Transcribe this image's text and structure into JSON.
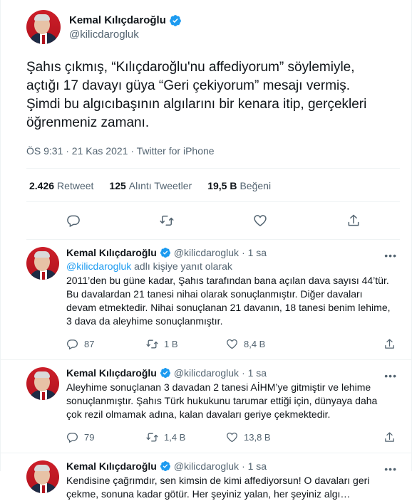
{
  "main_tweet": {
    "display_name": "Kemal Kılıçdaroğlu",
    "handle": "@kilicdarogluk",
    "text": "Şahıs çıkmış, “Kılıçdaroğlu'nu affediyorum” söylemiyle, açtığı 17 davayı güya “Geri çekiyorum” mesajı vermiş. Şimdi bu algıcıbaşının algılarını bir kenara itip, gerçekleri öğrenmeniz zamanı.",
    "meta": "ÖS 9:31 · 21 Kas 2021 · Twitter for iPhone",
    "stats": {
      "retweets_count": "2.426",
      "retweets_label": "Retweet",
      "quotes_count": "125",
      "quotes_label": "Alıntı Tweetler",
      "likes_count": "19,5 B",
      "likes_label": "Beğeni"
    }
  },
  "replies": [
    {
      "display_name": "Kemal Kılıçdaroğlu",
      "handle": "@kilicdarogluk",
      "time": "· 1 sa",
      "replying_to": "@kilicdarogluk",
      "replying_suffix": "adlı kişiye yanıt olarak",
      "text": "2011’den bu güne kadar, Şahıs tarafından bana açılan dava sayısı 44’tür. Bu davalardan 21 tanesi nihai olarak sonuçlanmıştır. Diğer davaları devam etmektedir. Nihai sonuçlanan 21 davanın, 18 tanesi benim lehime, 3 dava da aleyhime sonuçlanmıştır.",
      "reply_count": "87",
      "retweet_count": "1 B",
      "like_count": "8,4 B"
    },
    {
      "display_name": "Kemal Kılıçdaroğlu",
      "handle": "@kilicdarogluk",
      "time": "· 1 sa",
      "text": "Aleyhime sonuçlanan 3 davadan 2 tanesi AİHM’ye gitmiştir ve lehime sonuçlanmıştır. Şahıs Türk hukukunu tarumar ettiği için, dünyaya daha çok rezil olmamak adına, kalan davaları geriye çekmektedir.",
      "reply_count": "79",
      "retweet_count": "1,4 B",
      "like_count": "13,8 B"
    },
    {
      "display_name": "Kemal Kılıçdaroğlu",
      "handle": "@kilicdarogluk",
      "time": "· 1 sa",
      "text": "Kendisine çağrımdır, sen kimsin de kimi affediyorsun! O davaları geri çekme, sonuna kadar götür. Her şeyiniz yalan, her şeyiniz algı…"
    }
  ],
  "colors": {
    "accent": "#1d9bf0",
    "gray": "#536471",
    "verified": "#1d9bf0"
  },
  "icons": [
    "verified-badge-icon",
    "reply-icon",
    "retweet-icon",
    "like-icon",
    "share-icon",
    "more-icon"
  ]
}
